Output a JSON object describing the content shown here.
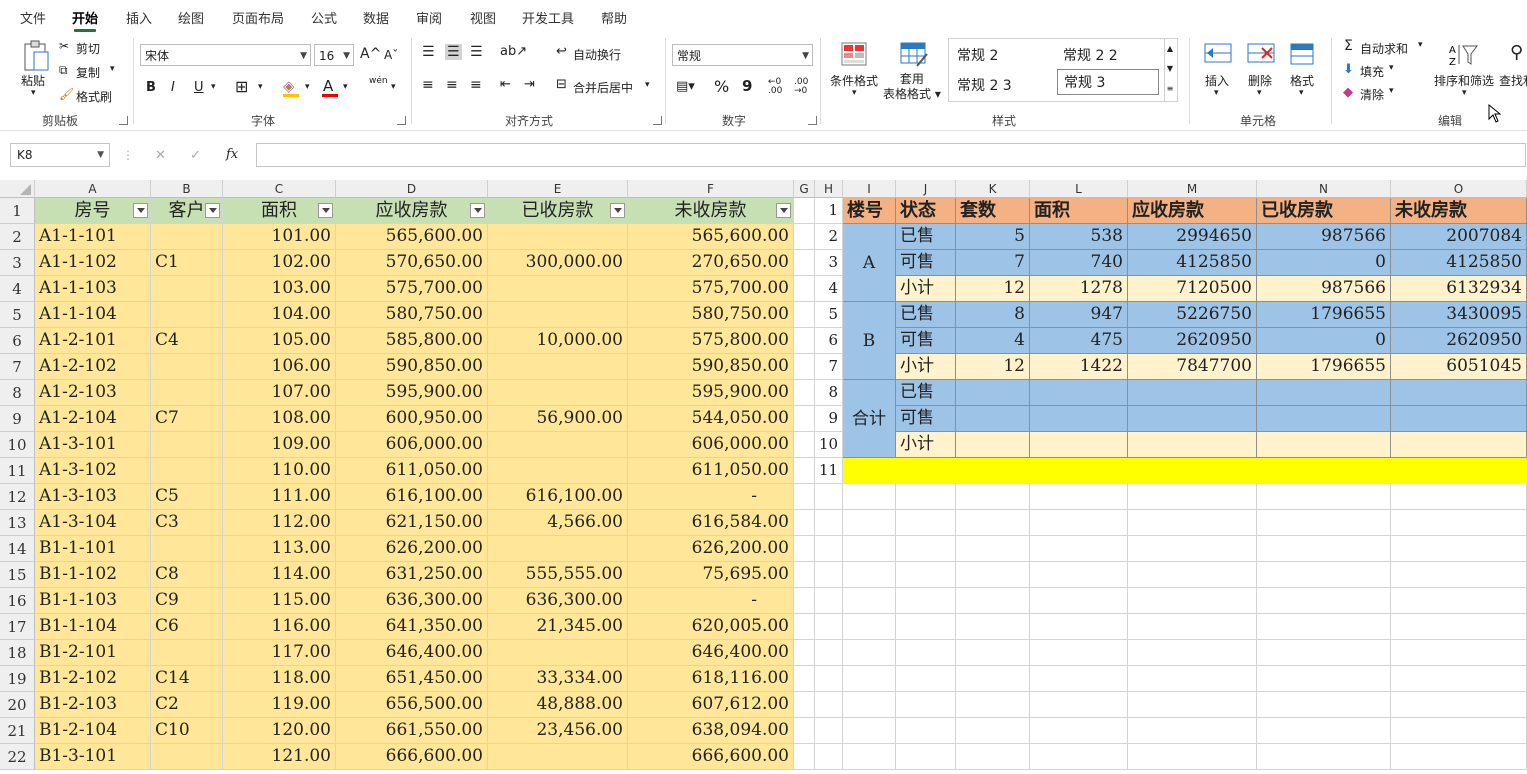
{
  "tabs": [
    "文件",
    "开始",
    "插入",
    "绘图",
    "页面布局",
    "公式",
    "数据",
    "审阅",
    "视图",
    "开发工具",
    "帮助"
  ],
  "ribbon": {
    "clipboard": {
      "paste": "粘贴",
      "cut": "剪切",
      "copy": "复制",
      "format_painter": "格式刷",
      "label": "剪贴板"
    },
    "font": {
      "name": "宋体",
      "size": "16",
      "label": "字体",
      "bold": "B",
      "italic": "I",
      "underline": "U",
      "phonetic": "wén"
    },
    "align": {
      "wrap": "自动换行",
      "merge": "合并后居中",
      "label": "对齐方式"
    },
    "number": {
      "format": "常规",
      "percent": "%",
      "comma": "9",
      "label": "数字"
    },
    "styles": {
      "cond": "条件格式",
      "table_fmt": "套用\n表格格式",
      "label": "样式",
      "gallery": [
        "常规 2",
        "常规 2 2",
        "常规 2 3",
        "常规 3"
      ]
    },
    "cells": {
      "insert": "插入",
      "delete": "删除",
      "format": "格式",
      "label": "单元格"
    },
    "edit": {
      "autosum": "自动求和",
      "fill": "填充",
      "clear": "清除",
      "sort": "排序和筛选",
      "find": "查找和",
      "label": "编辑"
    }
  },
  "formula_bar": {
    "namebox": "K8",
    "fx": "fx",
    "cancel": "✕",
    "confirm": "✓"
  },
  "columns": [
    "A",
    "B",
    "C",
    "D",
    "E",
    "F",
    "G",
    "H",
    "I",
    "J",
    "K",
    "L",
    "M",
    "N",
    "O"
  ],
  "left_table": {
    "headers": [
      "房号",
      "客户",
      "面积",
      "应收房款",
      "已收房款",
      "未收房款"
    ],
    "rows": [
      [
        "A1-1-101",
        "",
        "101.00",
        "565,600.00",
        "",
        "565,600.00"
      ],
      [
        "A1-1-102",
        "C1",
        "102.00",
        "570,650.00",
        "300,000.00",
        "270,650.00"
      ],
      [
        "A1-1-103",
        "",
        "103.00",
        "575,700.00",
        "",
        "575,700.00"
      ],
      [
        "A1-1-104",
        "",
        "104.00",
        "580,750.00",
        "",
        "580,750.00"
      ],
      [
        "A1-2-101",
        "C4",
        "105.00",
        "585,800.00",
        "10,000.00",
        "575,800.00"
      ],
      [
        "A1-2-102",
        "",
        "106.00",
        "590,850.00",
        "",
        "590,850.00"
      ],
      [
        "A1-2-103",
        "",
        "107.00",
        "595,900.00",
        "",
        "595,900.00"
      ],
      [
        "A1-2-104",
        "C7",
        "108.00",
        "600,950.00",
        "56,900.00",
        "544,050.00"
      ],
      [
        "A1-3-101",
        "",
        "109.00",
        "606,000.00",
        "",
        "606,000.00"
      ],
      [
        "A1-3-102",
        "",
        "110.00",
        "611,050.00",
        "",
        "611,050.00"
      ],
      [
        "A1-3-103",
        "C5",
        "111.00",
        "616,100.00",
        "616,100.00",
        "-"
      ],
      [
        "A1-3-104",
        "C3",
        "112.00",
        "621,150.00",
        "4,566.00",
        "616,584.00"
      ],
      [
        "B1-1-101",
        "",
        "113.00",
        "626,200.00",
        "",
        "626,200.00"
      ],
      [
        "B1-1-102",
        "C8",
        "114.00",
        "631,250.00",
        "555,555.00",
        "75,695.00"
      ],
      [
        "B1-1-103",
        "C9",
        "115.00",
        "636,300.00",
        "636,300.00",
        "-"
      ],
      [
        "B1-1-104",
        "C6",
        "116.00",
        "641,350.00",
        "21,345.00",
        "620,005.00"
      ],
      [
        "B1-2-101",
        "",
        "117.00",
        "646,400.00",
        "",
        "646,400.00"
      ],
      [
        "B1-2-102",
        "C14",
        "118.00",
        "651,450.00",
        "33,334.00",
        "618,116.00"
      ],
      [
        "B1-2-103",
        "C2",
        "119.00",
        "656,500.00",
        "48,888.00",
        "607,612.00"
      ],
      [
        "B1-2-104",
        "C10",
        "120.00",
        "661,550.00",
        "23,456.00",
        "638,094.00"
      ],
      [
        "B1-3-101",
        "",
        "121.00",
        "666,600.00",
        "",
        "666,600.00"
      ]
    ]
  },
  "right_table": {
    "headers": [
      "楼号",
      "状态",
      "套数",
      "面积",
      "应收房款",
      "已收房款",
      "未收房款"
    ],
    "groups": [
      "A",
      "B",
      "合计"
    ],
    "rows": [
      [
        "已售",
        "5",
        "538",
        "2994650",
        "987566",
        "2007084"
      ],
      [
        "可售",
        "7",
        "740",
        "4125850",
        "0",
        "4125850"
      ],
      [
        "小计",
        "12",
        "1278",
        "7120500",
        "987566",
        "6132934"
      ],
      [
        "已售",
        "8",
        "947",
        "5226750",
        "1796655",
        "3430095"
      ],
      [
        "可售",
        "4",
        "475",
        "2620950",
        "0",
        "2620950"
      ],
      [
        "小计",
        "12",
        "1422",
        "7847700",
        "1796655",
        "6051045"
      ],
      [
        "已售",
        "",
        "",
        "",
        "",
        ""
      ],
      [
        "可售",
        "",
        "",
        "",
        "",
        ""
      ],
      [
        "小计",
        "",
        "",
        "",
        "",
        ""
      ]
    ]
  },
  "colors": {
    "left_header": "#c6e0b4",
    "left_data": "#ffe699",
    "right_header": "#f4b183",
    "blue": "#9dc3e6",
    "cream": "#fff2cc",
    "highlight": "#ffff00",
    "accent": "#1f7244"
  }
}
